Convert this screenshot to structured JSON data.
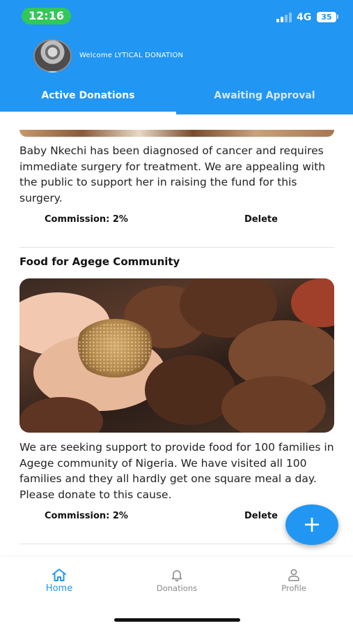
{
  "status_bar": {
    "time": "12:16",
    "network": "4G",
    "battery": "35"
  },
  "header": {
    "welcome": "Welcome LYTICAL DONATION",
    "avatar_icon": "user-avatar",
    "accent_color": "#2196f3"
  },
  "tabs": [
    {
      "label": "Active Donations",
      "active": true
    },
    {
      "label": "Awaiting Approval",
      "active": false
    }
  ],
  "donations": [
    {
      "title": "",
      "description": "Baby Nkechi has been diagnosed of cancer and requires immediate surgery for treatment. We are appealing with the public to support her in raising the fund for this surgery.",
      "commission": "Commission: 2%",
      "delete_label": "Delete"
    },
    {
      "title": "Food for Agege Community",
      "description": "We are seeking support to provide food for 100 families in Agege community of Nigeria. We have visited all 100 families and they all hardly get one square meal a day. Please donate to this cause.",
      "commission": "Commission: 2%",
      "delete_label": "Delete"
    }
  ],
  "fab": {
    "label": "+",
    "icon": "plus-icon"
  },
  "bottom_nav": [
    {
      "label": "Home",
      "icon": "home-icon",
      "active": true
    },
    {
      "label": "Donations",
      "icon": "bell-icon",
      "active": false
    },
    {
      "label": "Profile",
      "icon": "person-icon",
      "active": false
    }
  ]
}
